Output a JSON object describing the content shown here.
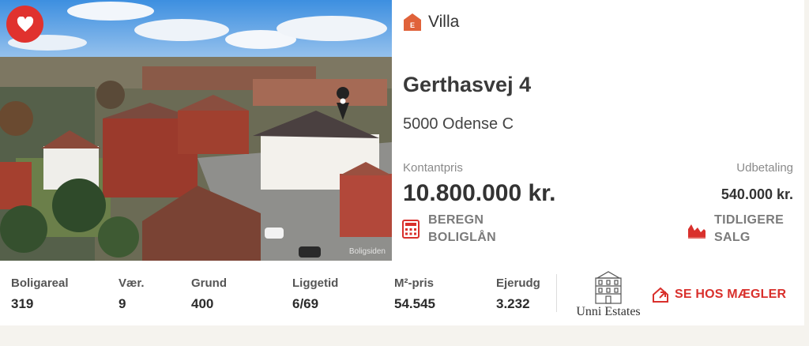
{
  "listing": {
    "type": "Villa",
    "address": "Gerthasvej 4",
    "city": "5000 Odense C",
    "price_label": "Kontantpris",
    "price": "10.800.000 kr.",
    "downpayment_label": "Udbetaling",
    "downpayment": "540.000 kr.",
    "calc_action": "BEREGN BOLIGLÅN",
    "sales_action": "TIDLIGERE SALG",
    "photo_watermark": "Boligsiden",
    "favorite_icon": "heart-icon"
  },
  "stats": [
    {
      "label": "Boligareal",
      "value": "319"
    },
    {
      "label": "Vær.",
      "value": "9"
    },
    {
      "label": "Grund",
      "value": "400"
    },
    {
      "label": "Liggetid",
      "value": "6/69"
    },
    {
      "label": "M²-pris",
      "value": "54.545"
    },
    {
      "label": "Ejerudg",
      "value": "3.232"
    }
  ],
  "broker": {
    "name": "Unni Estates",
    "cta": "SE HOS MÆGLER"
  },
  "colors": {
    "accent_red": "#d9302c",
    "favorite_bg": "#e0322e",
    "villa_icon": "#e0623a"
  }
}
